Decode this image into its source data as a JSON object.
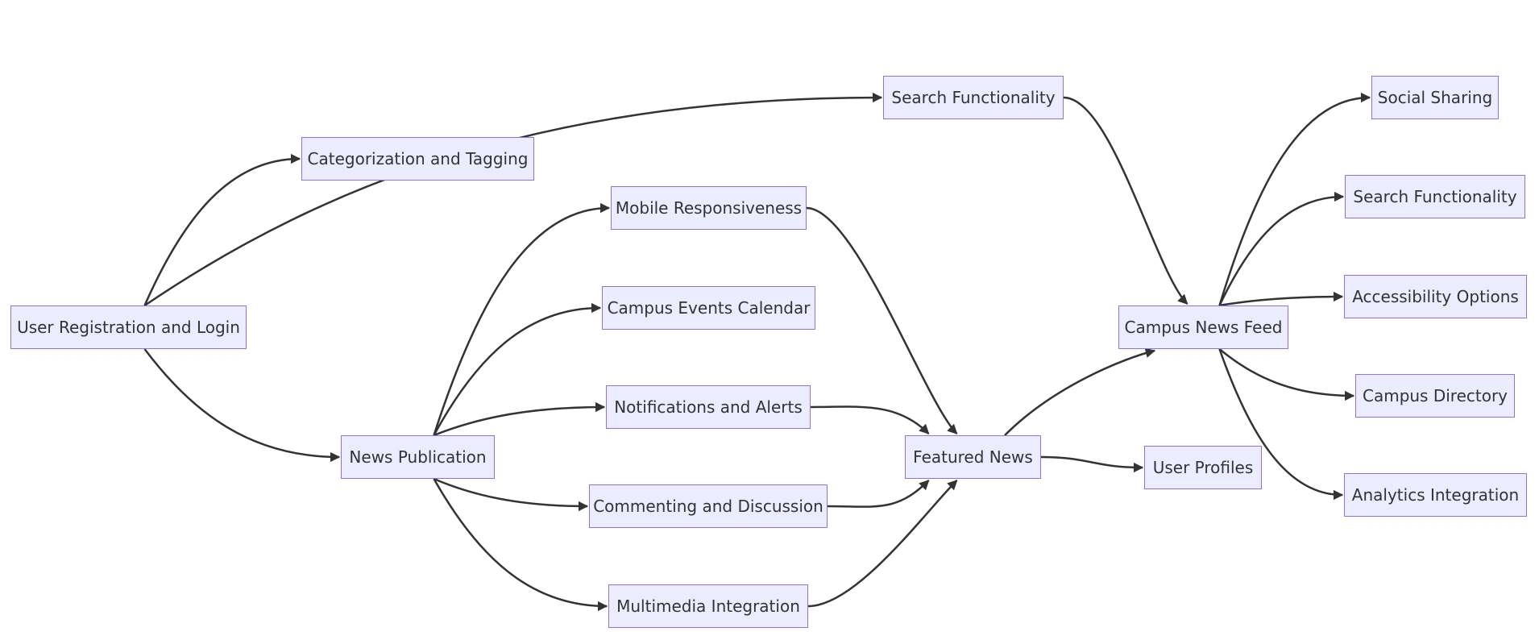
{
  "diagram": {
    "type": "flowchart",
    "direction": "left-to-right",
    "colors": {
      "node_fill": "#ECECFF",
      "node_border": "#9370DB",
      "text": "#333333",
      "edge": "#333333",
      "background": "#FFFFFF"
    },
    "nodes": [
      {
        "id": "user_reg",
        "label": "User Registration and Login"
      },
      {
        "id": "search1",
        "label": "Search Functionality"
      },
      {
        "id": "categorization",
        "label": "Categorization and Tagging"
      },
      {
        "id": "news_pub",
        "label": "News Publication"
      },
      {
        "id": "mobile",
        "label": "Mobile Responsiveness"
      },
      {
        "id": "events",
        "label": "Campus Events Calendar"
      },
      {
        "id": "notifications",
        "label": "Notifications and Alerts"
      },
      {
        "id": "commenting",
        "label": "Commenting and Discussion"
      },
      {
        "id": "multimedia",
        "label": "Multimedia Integration"
      },
      {
        "id": "featured",
        "label": "Featured News"
      },
      {
        "id": "feed",
        "label": "Campus News Feed"
      },
      {
        "id": "profiles",
        "label": "User Profiles"
      },
      {
        "id": "social",
        "label": "Social Sharing"
      },
      {
        "id": "search2",
        "label": "Search Functionality"
      },
      {
        "id": "accessibility",
        "label": "Accessibility Options"
      },
      {
        "id": "directory",
        "label": "Campus Directory"
      },
      {
        "id": "analytics",
        "label": "Analytics Integration"
      }
    ],
    "edges": [
      {
        "from": "user_reg",
        "to": "search1"
      },
      {
        "from": "user_reg",
        "to": "categorization"
      },
      {
        "from": "user_reg",
        "to": "news_pub"
      },
      {
        "from": "news_pub",
        "to": "mobile"
      },
      {
        "from": "news_pub",
        "to": "events"
      },
      {
        "from": "news_pub",
        "to": "notifications"
      },
      {
        "from": "news_pub",
        "to": "commenting"
      },
      {
        "from": "news_pub",
        "to": "multimedia"
      },
      {
        "from": "mobile",
        "to": "featured"
      },
      {
        "from": "notifications",
        "to": "featured"
      },
      {
        "from": "commenting",
        "to": "featured"
      },
      {
        "from": "multimedia",
        "to": "featured"
      },
      {
        "from": "search1",
        "to": "feed"
      },
      {
        "from": "featured",
        "to": "feed"
      },
      {
        "from": "featured",
        "to": "profiles"
      },
      {
        "from": "feed",
        "to": "social"
      },
      {
        "from": "feed",
        "to": "search2"
      },
      {
        "from": "feed",
        "to": "accessibility"
      },
      {
        "from": "feed",
        "to": "directory"
      },
      {
        "from": "feed",
        "to": "analytics"
      }
    ]
  }
}
